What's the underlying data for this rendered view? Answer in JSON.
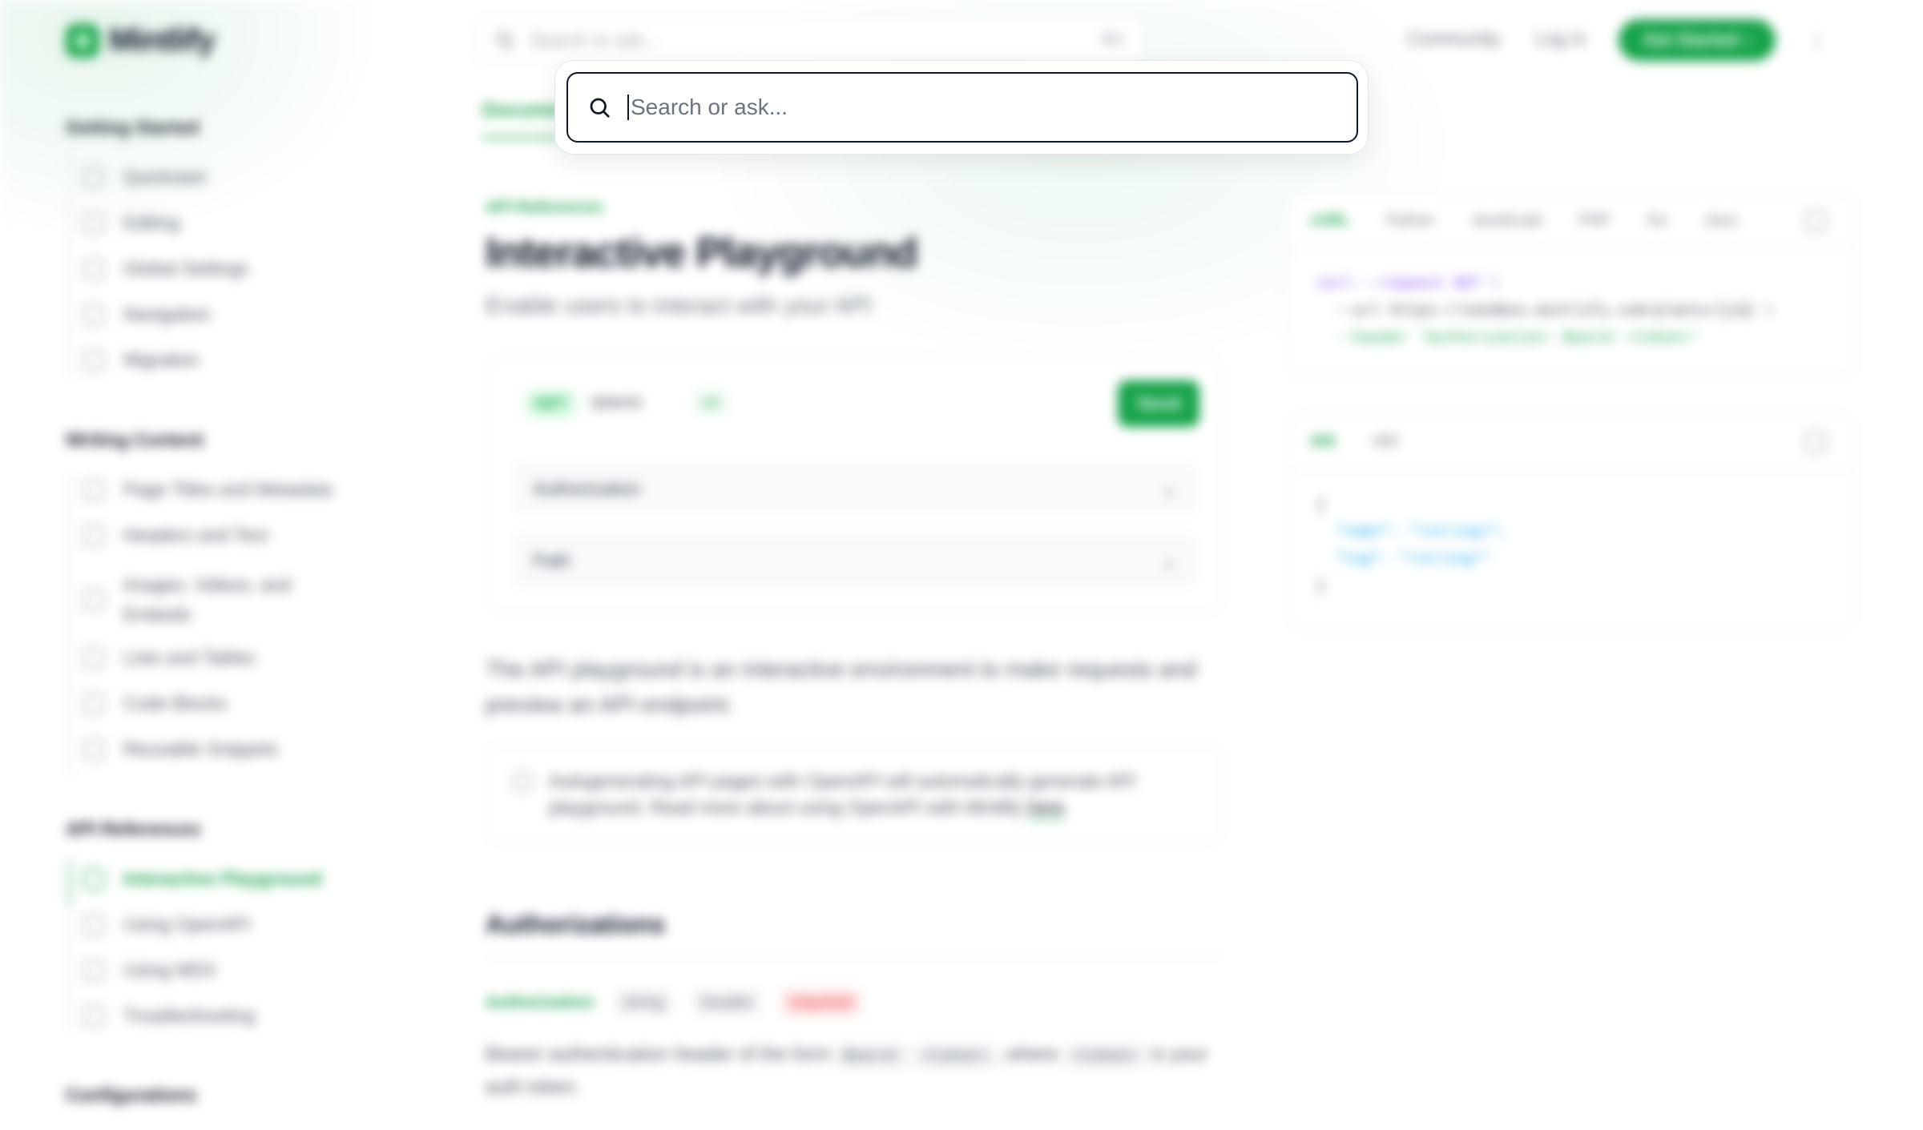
{
  "header": {
    "brand": "Mintlify",
    "search_placeholder": "Search or ask...",
    "search_shortcut": "⌘K",
    "links": [
      "Community",
      "Log In"
    ],
    "cta": "Get Started",
    "more": "⋮"
  },
  "tabs": {
    "active": "Documentation"
  },
  "sidebar": {
    "groups": [
      {
        "title": "Getting Started",
        "items": [
          "Quickstart",
          "Editing",
          "Global Settings",
          "Navigation",
          "Migration"
        ]
      },
      {
        "title": "Writing Content",
        "items": [
          "Page Titles and Metadata",
          "Headers and Text",
          "Images, Videos, and Embeds",
          "Lists and Tables",
          "Code Blocks",
          "Reusable Snippets"
        ]
      },
      {
        "title": "API References",
        "items": [
          "Interactive Playground",
          "Using OpenAPI",
          "Using MDX",
          "Troubleshooting"
        ]
      },
      {
        "title": "Configurations",
        "items": []
      }
    ],
    "active_item": "Interactive Playground"
  },
  "main": {
    "eyebrow": "API References",
    "title": "Interactive Playground",
    "subtitle": "Enable users to interact with your API",
    "playground": {
      "method": "GET",
      "path": "/plants",
      "path_badge": "{id}",
      "send": "Send",
      "rows": [
        "Authorization",
        "Path"
      ]
    },
    "paragraph": "The API playground is an interactive environment to make requests and preview an API endpoint.",
    "note": "Autogenerating API pages with OpenAPI will automatically generate API playground. Read more about using OpenAPI with Mintlify ",
    "note_link": "here",
    "section_title": "Authorizations",
    "param": {
      "name": "Authorization",
      "type": "string",
      "location": "header",
      "required": "required"
    },
    "param_desc_1": "Bearer authentication header of the form ",
    "param_chip_1": "Bearer",
    "param_chip_2": "<token>",
    "param_desc_2": ", where ",
    "param_chip_3": "<token>",
    "param_desc_3": " is your auth token."
  },
  "request_panel": {
    "tabs": [
      "cURL",
      "Python",
      "JavaScript",
      "PHP",
      "Go",
      "Java"
    ],
    "lines": [
      "curl --request GET \\",
      "  --url https://sandbox.mintlify.com/plants/{id} \\",
      "  --header 'Authorization: Bearer <token>'"
    ]
  },
  "response_panel": {
    "tabs": [
      "200",
      "400"
    ],
    "lines": [
      "{",
      "  \"name\": \"<string>\",",
      "  \"tag\": \"<string>\"",
      "}"
    ]
  },
  "search_modal": {
    "placeholder": "Search or ask...",
    "value": ""
  },
  "colors": {
    "accent": "#16a34a",
    "text": "#111827",
    "muted": "#6b7280"
  }
}
